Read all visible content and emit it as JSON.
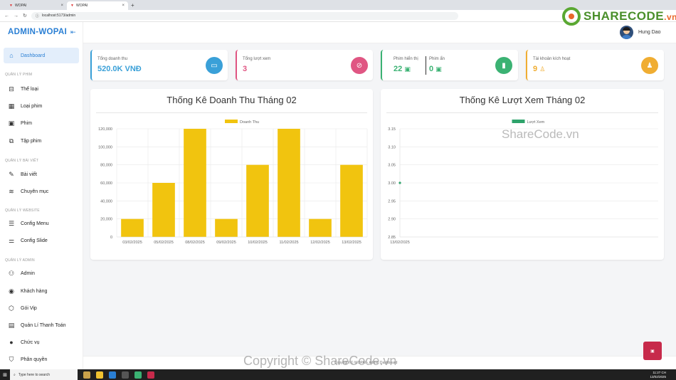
{
  "browser": {
    "tabs": [
      {
        "title": "WOPAI"
      },
      {
        "title": "WOPAI"
      }
    ],
    "url": "localhost:5173/admin"
  },
  "app": {
    "brand": "ADMIN-WOPAI",
    "user": "Hung Dao"
  },
  "sidebar": {
    "dashboard": "Dashboard",
    "sections": [
      {
        "title": "QUẢN LÝ PHIM",
        "items": [
          "Thể loại",
          "Loại phim",
          "Phim",
          "Tập phim"
        ]
      },
      {
        "title": "QUẢN LÝ BÀI VIẾT",
        "items": [
          "Bài viết",
          "Chuyên mục"
        ]
      },
      {
        "title": "QUẢN LÝ WEBSITE",
        "items": [
          "Config Menu",
          "Config Slide"
        ]
      },
      {
        "title": "QUẢN LÝ ADMIN",
        "items": [
          "Admin",
          "Khách hàng",
          "Gói Vip",
          "Quản Lí Thanh Toán",
          "Chức vụ",
          "Phân quyền"
        ]
      }
    ]
  },
  "stats": {
    "revenue": {
      "label": "Tổng doanh thu",
      "value": "520.0K VNĐ",
      "color": "#3aa0d8"
    },
    "views": {
      "label": "Tổng lượt xem",
      "value": "3",
      "color": "#e05683"
    },
    "showing": {
      "label": "Phim hiển thị",
      "value": "22",
      "color": "#3bb273"
    },
    "hidden": {
      "label": "Phim ẩn",
      "value": "0"
    },
    "accounts": {
      "label": "Tài khoản kích hoạt",
      "value": "9",
      "color": "#f0ad32"
    }
  },
  "chart_data": [
    {
      "type": "bar",
      "title": "Thống Kê Doanh Thu Tháng 02",
      "categories": [
        "03/02/2025",
        "05/02/2025",
        "08/02/2025",
        "09/02/2025",
        "10/02/2025",
        "11/02/2025",
        "12/02/2025",
        "13/02/2025"
      ],
      "series": [
        {
          "name": "Doanh Thu",
          "values": [
            20000,
            60000,
            120000,
            20000,
            80000,
            120000,
            20000,
            80000
          ],
          "color": "#f1c40f"
        }
      ],
      "ylim": [
        0,
        120000
      ],
      "yticks": [
        "0",
        "20,000",
        "40,000",
        "60,000",
        "80,000",
        "100,000",
        "120,000"
      ],
      "grid": true,
      "legend": "top"
    },
    {
      "type": "line",
      "title": "Thống Kê Lượt Xem Tháng 02",
      "categories": [
        "13/02/2025"
      ],
      "series": [
        {
          "name": "Lượt Xem",
          "values": [
            3
          ],
          "color": "#2ea36b"
        }
      ],
      "ylim": [
        2.85,
        3.15
      ],
      "yticks": [
        "2.85",
        "2.90",
        "2.95",
        "3.00",
        "3.05",
        "3.10",
        "3.15"
      ],
      "grid": true,
      "legend": "top"
    }
  ],
  "footer": {
    "text": "Copyright © WOPAI - Admin Dashboard"
  },
  "watermark": {
    "bottom": "Copyright © ShareCode.vn",
    "middle": "ShareCode.vn",
    "logo": "SHARECODE",
    "logo_suffix": ".vn"
  },
  "taskbar": {
    "search": "Type here to search",
    "time": "11:27 CH",
    "date": "13/02/2025"
  }
}
